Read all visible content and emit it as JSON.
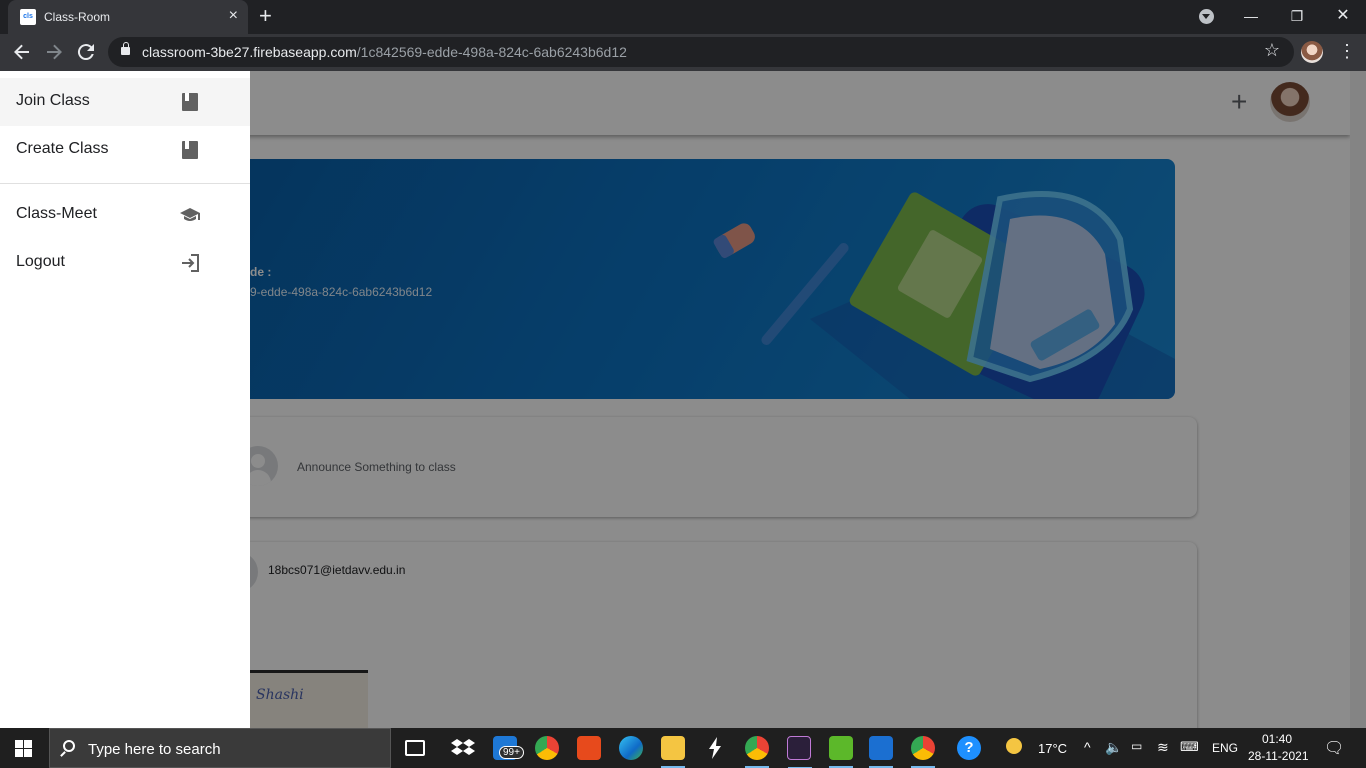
{
  "browser": {
    "tab_title": "Class-Room",
    "favicon_text": "cls",
    "url_host": "classroom-3be27.firebaseapp.com",
    "url_path": "/1c842569-edde-498a-824c-6ab6243b6d12",
    "new_tab": "+",
    "close_tab": "×"
  },
  "window": {
    "minimize": "—",
    "restore": "❐",
    "close": "✕"
  },
  "drawer": {
    "items": [
      {
        "label": "Join Class",
        "icon": "book-icon"
      },
      {
        "label": "Create Class",
        "icon": "book-icon"
      },
      {
        "label": "Class-Meet",
        "icon": "school-icon"
      },
      {
        "label": "Logout",
        "icon": "logout-icon"
      }
    ]
  },
  "header": {
    "add_label": "+"
  },
  "banner": {
    "code_label": "de :",
    "code_value": "9-edde-498a-824c-6ab6243b6d12"
  },
  "announce": {
    "placeholder": "Announce Something to class"
  },
  "post": {
    "author": "18bcs071@ietdavv.edu.in",
    "image_caption": "Shashi"
  },
  "taskbar": {
    "search_placeholder": "Type here to search",
    "mail_badge": "99+",
    "weather": "17°C",
    "language": "ENG",
    "time": "01:40",
    "date": "28-11-2021"
  },
  "colors": {
    "chrome_dark": "#202124",
    "chrome_toolbar": "#35363a",
    "banner_blue": "#0b72c2",
    "taskbar": "#1f1f1f"
  }
}
